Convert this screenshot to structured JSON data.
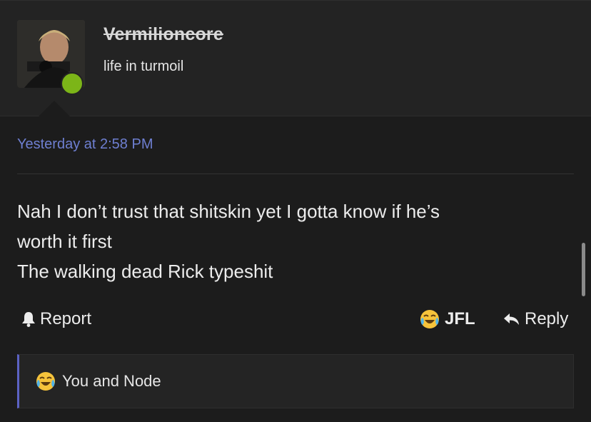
{
  "post": {
    "username": "Vermilioncore",
    "user_title": "life in turmoil",
    "date": "Yesterday at 2:58 PM",
    "message_lines": [
      "Nah I don’t trust that shitskin yet I gotta know if he’s",
      "worth it first",
      "The walking dead Rick typeshit"
    ]
  },
  "actions": {
    "report_label": "Report",
    "reaction_label": "JFL",
    "reply_label": "Reply"
  },
  "reactions": {
    "summary": "You and Node"
  },
  "icons": {
    "report": "bell-icon",
    "reaction": "crying-laughing-emoji-icon",
    "reply": "reply-arrow-icon"
  },
  "colors": {
    "accent": "#6e7fd1",
    "online": "#7cb518",
    "reaction_border": "#5b62c4",
    "background": "#1c1c1c"
  }
}
